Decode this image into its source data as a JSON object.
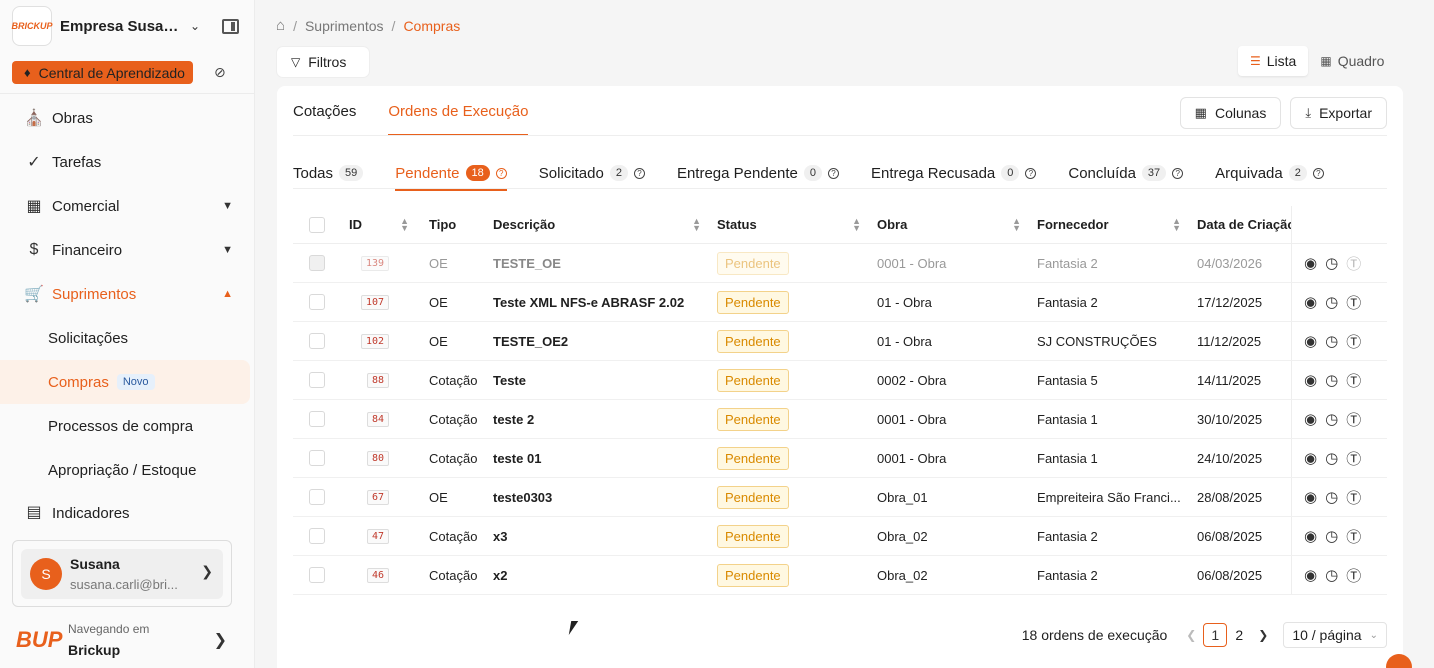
{
  "sidebar": {
    "company_name": "Empresa Susan...",
    "logo_text": "BRICKUP",
    "learning_center": "Central de Aprendizado",
    "nav": [
      {
        "label": "Obras",
        "icon": "bank-icon"
      },
      {
        "label": "Tarefas",
        "icon": "check-circle-icon"
      },
      {
        "label": "Comercial",
        "icon": "barcode-icon"
      },
      {
        "label": "Financeiro",
        "icon": "dollar-circle-icon"
      },
      {
        "label": "Suprimentos",
        "icon": "cart-icon"
      }
    ],
    "sub_nav": [
      "Solicitações",
      "Compras",
      "Processos de compra",
      "Apropriação / Estoque"
    ],
    "new_badge": "Novo",
    "next_nav": "Indicadores",
    "user": {
      "initial": "S",
      "name": "Susana",
      "email": "susana.carli@bri..."
    },
    "brand": {
      "logo": "BUP",
      "navigating_label": "Navegando em",
      "name": "Brickup"
    }
  },
  "breadcrumb": {
    "section": "Suprimentos",
    "current": "Compras"
  },
  "toolbar": {
    "filters": "Filtros",
    "view_list": "Lista",
    "view_board": "Quadro"
  },
  "main_tabs": [
    "Cotações",
    "Ordens de Execução"
  ],
  "actions": {
    "columns": "Colunas",
    "export": "Exportar"
  },
  "status_tabs": [
    {
      "label": "Todas",
      "count": "59"
    },
    {
      "label": "Pendente",
      "count": "18"
    },
    {
      "label": "Solicitado",
      "count": "2"
    },
    {
      "label": "Entrega Pendente",
      "count": "0"
    },
    {
      "label": "Entrega Recusada",
      "count": "0"
    },
    {
      "label": "Concluída",
      "count": "37"
    },
    {
      "label": "Arquivada",
      "count": "2"
    }
  ],
  "table": {
    "headers": {
      "id": "ID",
      "tipo": "Tipo",
      "descricao": "Descrição",
      "status": "Status",
      "obra": "Obra",
      "fornecedor": "Fornecedor",
      "data": "Data de Criação"
    },
    "rows": [
      {
        "id": "139",
        "tipo": "OE",
        "descricao": "TESTE_OE",
        "status": "Pendente",
        "obra": "0001 - Obra",
        "fornecedor": "Fantasia 2",
        "data": "04/03/2026"
      },
      {
        "id": "107",
        "tipo": "OE",
        "descricao": "Teste XML NFS-e ABRASF 2.02",
        "status": "Pendente",
        "obra": "01 - Obra",
        "fornecedor": "Fantasia 2",
        "data": "17/12/2025"
      },
      {
        "id": "102",
        "tipo": "OE",
        "descricao": "TESTE_OE2",
        "status": "Pendente",
        "obra": "01 - Obra",
        "fornecedor": "SJ CONSTRUÇÕES",
        "data": "11/12/2025"
      },
      {
        "id": "88",
        "tipo": "Cotação",
        "descricao": "Teste",
        "status": "Pendente",
        "obra": "0002 - Obra",
        "fornecedor": "Fantasia 5",
        "data": "14/11/2025"
      },
      {
        "id": "84",
        "tipo": "Cotação",
        "descricao": "teste 2",
        "status": "Pendente",
        "obra": "0001 - Obra",
        "fornecedor": "Fantasia 1",
        "data": "30/10/2025"
      },
      {
        "id": "80",
        "tipo": "Cotação",
        "descricao": "teste 01",
        "status": "Pendente",
        "obra": "0001 - Obra",
        "fornecedor": "Fantasia 1",
        "data": "24/10/2025"
      },
      {
        "id": "67",
        "tipo": "OE",
        "descricao": "teste0303",
        "status": "Pendente",
        "obra": "Obra_01",
        "fornecedor": "Empreiteira São Franci...",
        "data": "28/08/2025"
      },
      {
        "id": "47",
        "tipo": "Cotação",
        "descricao": "x3",
        "status": "Pendente",
        "obra": "Obra_02",
        "fornecedor": "Fantasia 2",
        "data": "06/08/2025"
      },
      {
        "id": "46",
        "tipo": "Cotação",
        "descricao": "x2",
        "status": "Pendente",
        "obra": "Obra_02",
        "fornecedor": "Fantasia 2",
        "data": "06/08/2025"
      }
    ]
  },
  "pagination": {
    "total": "18 ordens de execução",
    "pages": [
      "1",
      "2"
    ],
    "page_size": "10 / página"
  },
  "colors": {
    "accent": "#e8601c",
    "pending_text": "#d98a00",
    "pending_bg": "#fff8e1"
  }
}
